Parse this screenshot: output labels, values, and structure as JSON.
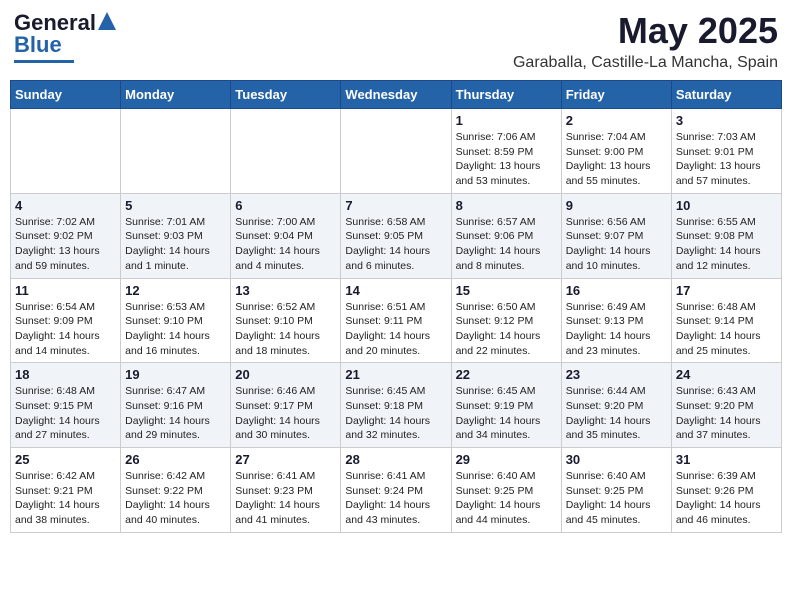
{
  "header": {
    "logo_general": "General",
    "logo_blue": "Blue",
    "month_title": "May 2025",
    "location": "Garaballa, Castille-La Mancha, Spain"
  },
  "days_of_week": [
    "Sunday",
    "Monday",
    "Tuesday",
    "Wednesday",
    "Thursday",
    "Friday",
    "Saturday"
  ],
  "weeks": [
    [
      {
        "day": "",
        "info": ""
      },
      {
        "day": "",
        "info": ""
      },
      {
        "day": "",
        "info": ""
      },
      {
        "day": "",
        "info": ""
      },
      {
        "day": "1",
        "info": "Sunrise: 7:06 AM\nSunset: 8:59 PM\nDaylight: 13 hours\nand 53 minutes."
      },
      {
        "day": "2",
        "info": "Sunrise: 7:04 AM\nSunset: 9:00 PM\nDaylight: 13 hours\nand 55 minutes."
      },
      {
        "day": "3",
        "info": "Sunrise: 7:03 AM\nSunset: 9:01 PM\nDaylight: 13 hours\nand 57 minutes."
      }
    ],
    [
      {
        "day": "4",
        "info": "Sunrise: 7:02 AM\nSunset: 9:02 PM\nDaylight: 13 hours\nand 59 minutes."
      },
      {
        "day": "5",
        "info": "Sunrise: 7:01 AM\nSunset: 9:03 PM\nDaylight: 14 hours\nand 1 minute."
      },
      {
        "day": "6",
        "info": "Sunrise: 7:00 AM\nSunset: 9:04 PM\nDaylight: 14 hours\nand 4 minutes."
      },
      {
        "day": "7",
        "info": "Sunrise: 6:58 AM\nSunset: 9:05 PM\nDaylight: 14 hours\nand 6 minutes."
      },
      {
        "day": "8",
        "info": "Sunrise: 6:57 AM\nSunset: 9:06 PM\nDaylight: 14 hours\nand 8 minutes."
      },
      {
        "day": "9",
        "info": "Sunrise: 6:56 AM\nSunset: 9:07 PM\nDaylight: 14 hours\nand 10 minutes."
      },
      {
        "day": "10",
        "info": "Sunrise: 6:55 AM\nSunset: 9:08 PM\nDaylight: 14 hours\nand 12 minutes."
      }
    ],
    [
      {
        "day": "11",
        "info": "Sunrise: 6:54 AM\nSunset: 9:09 PM\nDaylight: 14 hours\nand 14 minutes."
      },
      {
        "day": "12",
        "info": "Sunrise: 6:53 AM\nSunset: 9:10 PM\nDaylight: 14 hours\nand 16 minutes."
      },
      {
        "day": "13",
        "info": "Sunrise: 6:52 AM\nSunset: 9:10 PM\nDaylight: 14 hours\nand 18 minutes."
      },
      {
        "day": "14",
        "info": "Sunrise: 6:51 AM\nSunset: 9:11 PM\nDaylight: 14 hours\nand 20 minutes."
      },
      {
        "day": "15",
        "info": "Sunrise: 6:50 AM\nSunset: 9:12 PM\nDaylight: 14 hours\nand 22 minutes."
      },
      {
        "day": "16",
        "info": "Sunrise: 6:49 AM\nSunset: 9:13 PM\nDaylight: 14 hours\nand 23 minutes."
      },
      {
        "day": "17",
        "info": "Sunrise: 6:48 AM\nSunset: 9:14 PM\nDaylight: 14 hours\nand 25 minutes."
      }
    ],
    [
      {
        "day": "18",
        "info": "Sunrise: 6:48 AM\nSunset: 9:15 PM\nDaylight: 14 hours\nand 27 minutes."
      },
      {
        "day": "19",
        "info": "Sunrise: 6:47 AM\nSunset: 9:16 PM\nDaylight: 14 hours\nand 29 minutes."
      },
      {
        "day": "20",
        "info": "Sunrise: 6:46 AM\nSunset: 9:17 PM\nDaylight: 14 hours\nand 30 minutes."
      },
      {
        "day": "21",
        "info": "Sunrise: 6:45 AM\nSunset: 9:18 PM\nDaylight: 14 hours\nand 32 minutes."
      },
      {
        "day": "22",
        "info": "Sunrise: 6:45 AM\nSunset: 9:19 PM\nDaylight: 14 hours\nand 34 minutes."
      },
      {
        "day": "23",
        "info": "Sunrise: 6:44 AM\nSunset: 9:20 PM\nDaylight: 14 hours\nand 35 minutes."
      },
      {
        "day": "24",
        "info": "Sunrise: 6:43 AM\nSunset: 9:20 PM\nDaylight: 14 hours\nand 37 minutes."
      }
    ],
    [
      {
        "day": "25",
        "info": "Sunrise: 6:42 AM\nSunset: 9:21 PM\nDaylight: 14 hours\nand 38 minutes."
      },
      {
        "day": "26",
        "info": "Sunrise: 6:42 AM\nSunset: 9:22 PM\nDaylight: 14 hours\nand 40 minutes."
      },
      {
        "day": "27",
        "info": "Sunrise: 6:41 AM\nSunset: 9:23 PM\nDaylight: 14 hours\nand 41 minutes."
      },
      {
        "day": "28",
        "info": "Sunrise: 6:41 AM\nSunset: 9:24 PM\nDaylight: 14 hours\nand 43 minutes."
      },
      {
        "day": "29",
        "info": "Sunrise: 6:40 AM\nSunset: 9:25 PM\nDaylight: 14 hours\nand 44 minutes."
      },
      {
        "day": "30",
        "info": "Sunrise: 6:40 AM\nSunset: 9:25 PM\nDaylight: 14 hours\nand 45 minutes."
      },
      {
        "day": "31",
        "info": "Sunrise: 6:39 AM\nSunset: 9:26 PM\nDaylight: 14 hours\nand 46 minutes."
      }
    ]
  ]
}
